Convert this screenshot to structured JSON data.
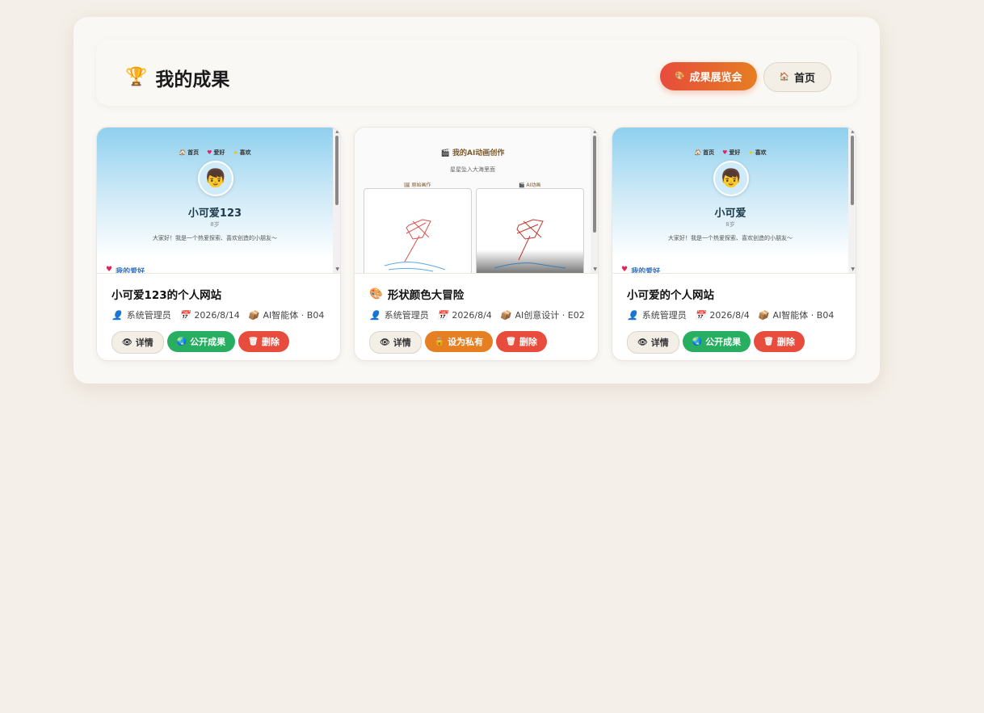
{
  "header": {
    "title": "我的成果",
    "title_icon": "🏆",
    "expo_button": "成果展览会",
    "expo_icon": "🎨",
    "home_button": "首页",
    "home_icon": "🏠"
  },
  "cards": [
    {
      "preview": {
        "type": "profile",
        "nav": [
          "首页",
          "爱好",
          "喜欢"
        ],
        "name": "小可爱123",
        "age": "8岁",
        "bio": "大家好！我是一个热爱探索、喜欢创造的小朋友～",
        "section": "我的爱好"
      },
      "title": "小可爱123的个人网站",
      "author": "系统管理员",
      "date": "2026/8/14",
      "category": "AI智能体 · B04",
      "actions": [
        "详情",
        "公开成果",
        "删除"
      ]
    },
    {
      "preview": {
        "type": "animation",
        "title": "我的AI动画创作",
        "subtitle": "星星坠入大海里面",
        "left_label": "原始画作",
        "right_label": "AI动画"
      },
      "title_icon": "🎨",
      "title": "形状颜色大冒险",
      "author": "系统管理员",
      "date": "2026/8/4",
      "category": "AI创意设计 · E02",
      "actions": [
        "详情",
        "设为私有",
        "删除"
      ]
    },
    {
      "preview": {
        "type": "profile",
        "nav": [
          "首页",
          "爱好",
          "喜欢"
        ],
        "name": "小可爱",
        "age": "8岁",
        "bio": "大家好！我是一个热爱探索、喜欢创造的小朋友～",
        "section": "我的爱好"
      },
      "title": "小可爱的个人网站",
      "author": "系统管理员",
      "date": "2026/8/4",
      "category": "AI智能体 · B04",
      "actions": [
        "详情",
        "公开成果",
        "删除"
      ]
    }
  ],
  "colors": {
    "public": "#27ae60",
    "private": "#e67e22",
    "delete": "#e74c3c",
    "expo_gradient": [
      "#e74c3c",
      "#e67e22"
    ]
  }
}
